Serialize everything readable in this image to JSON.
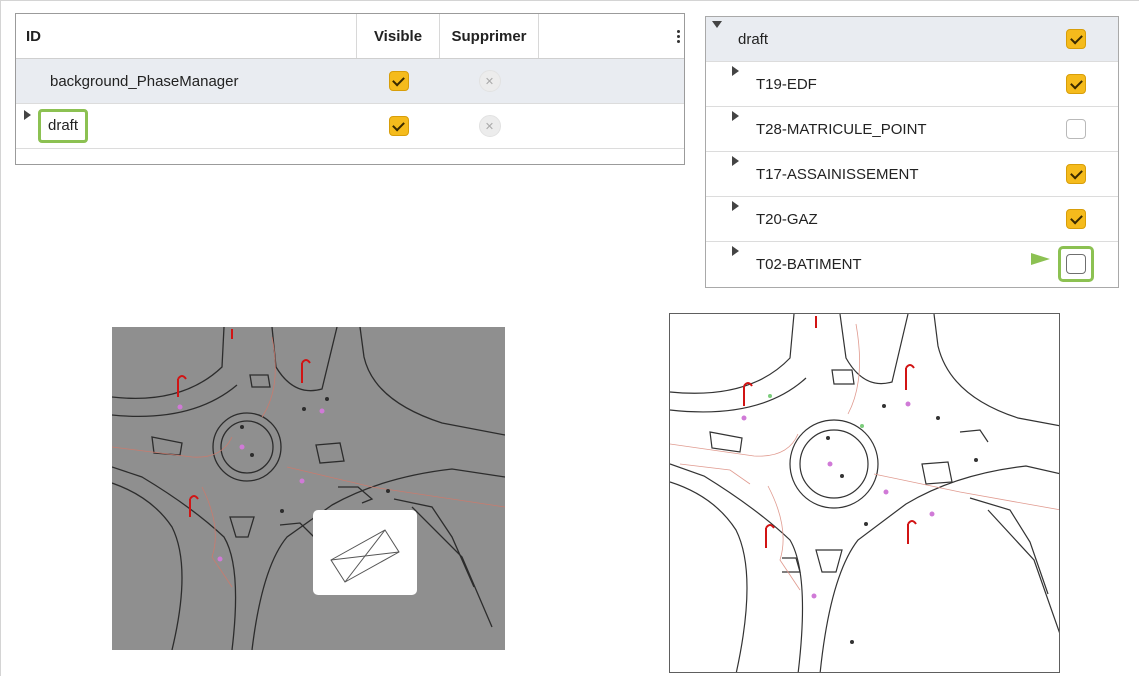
{
  "layer_table": {
    "columns": {
      "id": "ID",
      "visible": "Visible",
      "delete": "Supprimer"
    },
    "rows": [
      {
        "id": "background_PhaseManager",
        "visible": true
      },
      {
        "id": "draft",
        "visible": true
      }
    ]
  },
  "layer_tree": {
    "parent": {
      "label": "draft",
      "visible": true
    },
    "children": [
      {
        "label": "T19-EDF",
        "visible": true
      },
      {
        "label": "T28-MATRICULE_POINT",
        "visible": false
      },
      {
        "label": "T17-ASSAINISSEMENT",
        "visible": true
      },
      {
        "label": "T20-GAZ",
        "visible": true
      },
      {
        "label": "T02-BATIMENT",
        "visible": false
      }
    ]
  },
  "colors": {
    "checkbox_on": "#f5bb1c",
    "highlight": "#8cc152",
    "map_dark_bg": "#8f8f8f",
    "map_light_bg": "#ffffff"
  },
  "icons": {
    "expand": "triangle-right-icon",
    "collapse": "triangle-down-icon",
    "delete": "delete-circle-icon",
    "menu": "kebab-menu-icon",
    "layer_placeholder": "envelope-box-icon"
  }
}
